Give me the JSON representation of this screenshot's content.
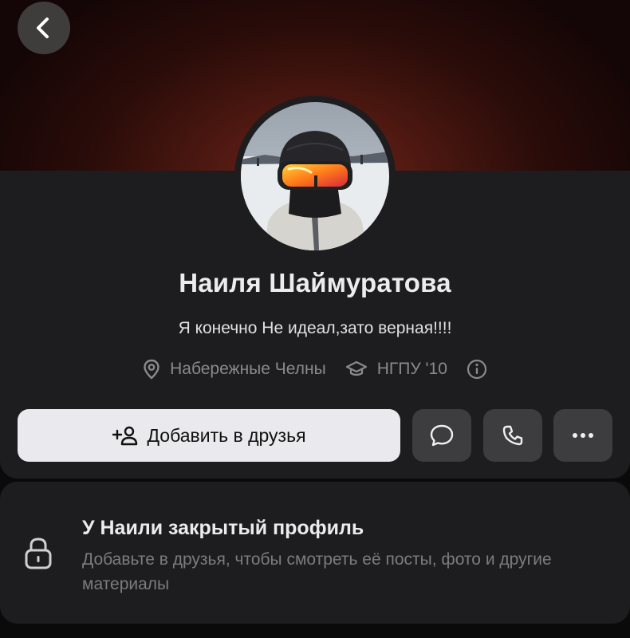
{
  "header": {
    "back_icon": "chevron-left-icon"
  },
  "profile": {
    "name": "Наиля Шаймуратова",
    "status": "Я конечно Не идеал,зато верная!!!!",
    "location": "Набережные Челны",
    "education": "НГПУ '10",
    "icons": {
      "location": "map-pin-icon",
      "education": "graduation-cap-icon",
      "info": "info-icon"
    }
  },
  "actions": {
    "add_friend_label": "Добавить в друзья",
    "message_icon": "message-bubble-icon",
    "call_icon": "phone-icon",
    "more_icon": "more-dots-icon"
  },
  "private_notice": {
    "title": "У Наили закрытый профиль",
    "description": "Добавьте в друзья, чтобы смотреть её посты, фото и другие материалы",
    "icon": "lock-icon"
  },
  "colors": {
    "background": "#0a0a0a",
    "card": "#1d1d1f",
    "cover_accent": "#70251b",
    "primary_button": "#e9e9ee",
    "secondary_button": "#3d3d40"
  }
}
